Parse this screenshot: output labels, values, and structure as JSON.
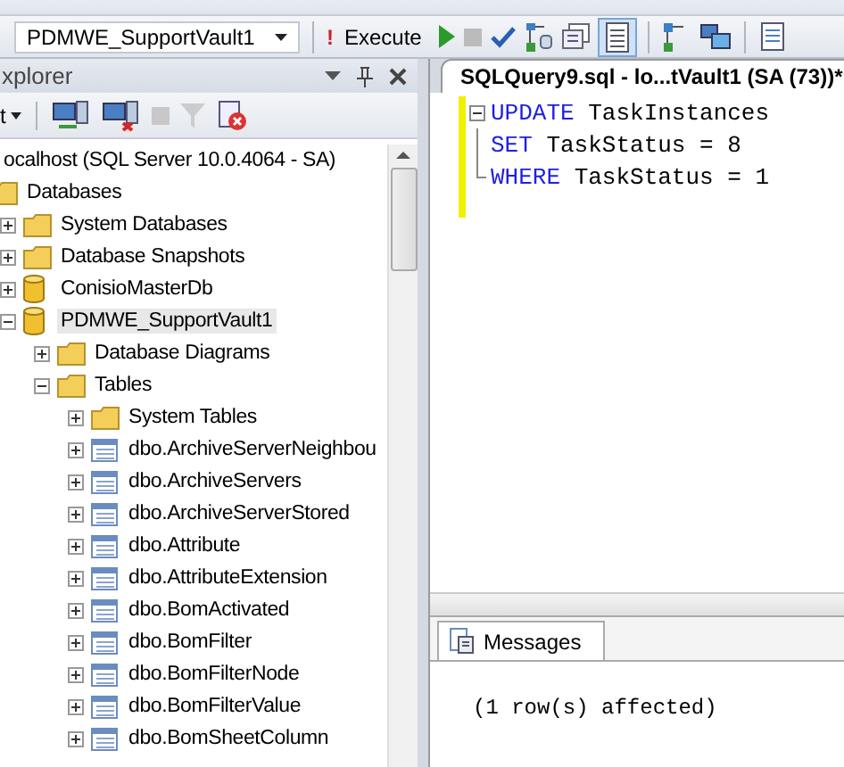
{
  "toolbar": {
    "database": "PDMWE_SupportVault1",
    "execute_mark": "!",
    "execute": "Execute"
  },
  "explorer": {
    "title": "xplorer",
    "connect_menu": "t",
    "tree": [
      {
        "label": "ocalhost (SQL Server 10.0.4064 - SA)",
        "selected": false,
        "children": [
          {
            "label": "Databases",
            "kind": "folder",
            "selected": false,
            "children": [
              {
                "label": "System Databases",
                "kind": "folder",
                "expanded": false,
                "selected": false
              },
              {
                "label": "Database Snapshots",
                "kind": "folder",
                "expanded": false,
                "selected": false
              },
              {
                "label": "ConisioMasterDb",
                "kind": "database",
                "expanded": false,
                "selected": false
              },
              {
                "label": "PDMWE_SupportVault1",
                "kind": "database",
                "expanded": true,
                "selected": true,
                "children": [
                  {
                    "label": "Database Diagrams",
                    "kind": "folder",
                    "expanded": false,
                    "selected": false
                  },
                  {
                    "label": "Tables",
                    "kind": "folder",
                    "expanded": true,
                    "selected": false,
                    "children": [
                      {
                        "label": "System Tables",
                        "kind": "folder",
                        "expanded": false,
                        "selected": false
                      },
                      {
                        "label": "dbo.ArchiveServerNeighbou",
                        "kind": "table",
                        "expanded": false,
                        "selected": false
                      },
                      {
                        "label": "dbo.ArchiveServers",
                        "kind": "table",
                        "expanded": false,
                        "selected": false
                      },
                      {
                        "label": "dbo.ArchiveServerStored",
                        "kind": "table",
                        "expanded": false,
                        "selected": false
                      },
                      {
                        "label": "dbo.Attribute",
                        "kind": "table",
                        "expanded": false,
                        "selected": false
                      },
                      {
                        "label": "dbo.AttributeExtension",
                        "kind": "table",
                        "expanded": false,
                        "selected": false
                      },
                      {
                        "label": "dbo.BomActivated",
                        "kind": "table",
                        "expanded": false,
                        "selected": false
                      },
                      {
                        "label": "dbo.BomFilter",
                        "kind": "table",
                        "expanded": false,
                        "selected": false
                      },
                      {
                        "label": "dbo.BomFilterNode",
                        "kind": "table",
                        "expanded": false,
                        "selected": false
                      },
                      {
                        "label": "dbo.BomFilterValue",
                        "kind": "table",
                        "expanded": false,
                        "selected": false
                      },
                      {
                        "label": "dbo.BomSheetColumn",
                        "kind": "table",
                        "expanded": false,
                        "selected": false
                      }
                    ]
                  }
                ]
              }
            ]
          }
        ]
      }
    ]
  },
  "editor": {
    "tab": "SQLQuery9.sql - lo...tVault1 (SA (73))*",
    "lines": [
      [
        {
          "kind": "keyword",
          "text": "UPDATE"
        },
        {
          "kind": "plain",
          "text": " TaskInstances"
        }
      ],
      [
        {
          "kind": "keyword",
          "text": "SET"
        },
        {
          "kind": "plain",
          "text": " TaskStatus = 8"
        }
      ],
      [
        {
          "kind": "keyword",
          "text": "WHERE"
        },
        {
          "kind": "plain",
          "text": " TaskStatus = 1"
        }
      ]
    ]
  },
  "results": {
    "tabs": [
      {
        "label": "Messages",
        "selected": true
      }
    ],
    "message": "(1 row(s) affected)"
  }
}
